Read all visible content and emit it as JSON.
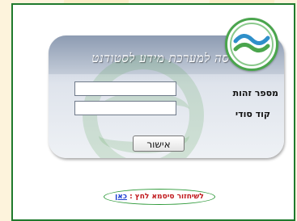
{
  "page": {
    "title": "כניסה למערכת מידע לסטודנט",
    "colors": {
      "frame": "#1f7a2d",
      "accent_red": "#c0171b",
      "link_blue": "#1b3fd1",
      "panel_header": "#8d9bb2"
    }
  },
  "logo": {
    "icon": "college-logo-icon"
  },
  "form": {
    "id_label": "מספר זהות",
    "id_value": "",
    "code_label": "קוד סודי",
    "code_value": "",
    "submit_label": "אישור"
  },
  "recover": {
    "text": "לשיחזור סיסמא לחץ :",
    "link_label": "כאן"
  }
}
